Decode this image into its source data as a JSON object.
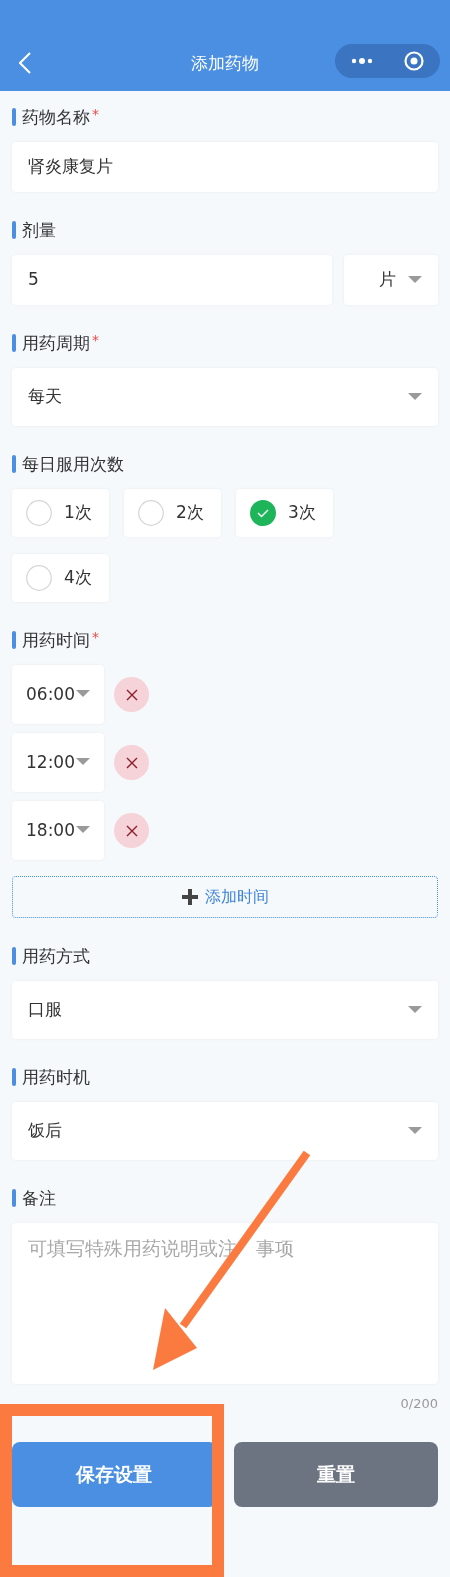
{
  "nav": {
    "title": "添加药物"
  },
  "fields": [
    {
      "kind": "text",
      "label": "药物名称",
      "required_mark": "*",
      "value": "肾炎康复片"
    },
    {
      "kind": "dose",
      "label": "剂量",
      "value": "5",
      "unit": "片"
    },
    {
      "kind": "select",
      "label": "用药周期",
      "required_mark": "*",
      "value": "每天"
    },
    {
      "kind": "radios",
      "label": "每日服用次数",
      "options": [
        {
          "label": "1次",
          "selected": false
        },
        {
          "label": "2次",
          "selected": false
        },
        {
          "label": "3次",
          "selected": true
        },
        {
          "label": "4次",
          "selected": false
        }
      ]
    },
    {
      "kind": "times",
      "label": "用药时间",
      "required_mark": "*",
      "times": [
        "06:00",
        "12:00",
        "18:00"
      ],
      "add_label": "添加时间"
    },
    {
      "kind": "select",
      "label": "用药方式",
      "value": "口服"
    },
    {
      "kind": "select",
      "label": "用药时机",
      "value": "饭后"
    },
    {
      "kind": "textarea",
      "label": "备注",
      "placeholder_parts": [
        "可填写特殊用药说明或注",
        "事项"
      ],
      "counter": "0/200"
    }
  ],
  "actions": [
    {
      "kind": "primary",
      "label": "保存设置"
    },
    {
      "kind": "secondary",
      "label": "重置"
    }
  ]
}
